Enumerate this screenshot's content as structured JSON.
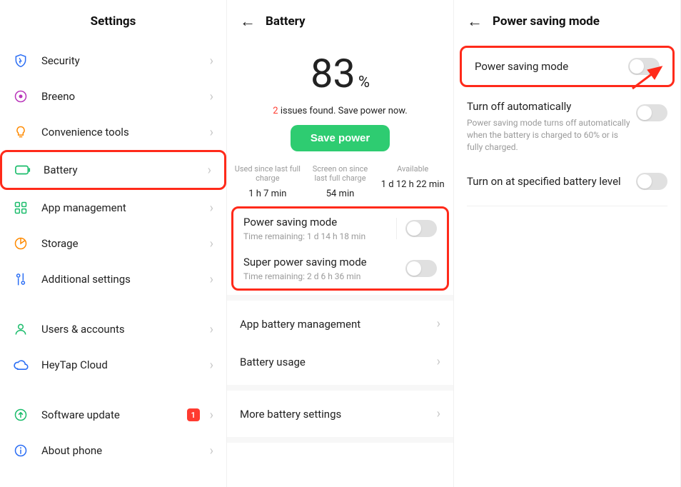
{
  "panel1": {
    "title": "Settings",
    "items": [
      {
        "label": "Security",
        "icon": "shield",
        "color": "#2a6df4"
      },
      {
        "label": "Breeno",
        "icon": "circle-dot",
        "color": "#b935ba"
      },
      {
        "label": "Convenience tools",
        "icon": "bulb",
        "color": "#ff8a00"
      },
      {
        "label": "Battery",
        "icon": "battery",
        "color": "#1abc6b",
        "highlight": true
      },
      {
        "label": "App management",
        "icon": "grid",
        "color": "#1abc6b"
      },
      {
        "label": "Storage",
        "icon": "pie",
        "color": "#ff8a00"
      },
      {
        "label": "Additional settings",
        "icon": "sliders",
        "color": "#2a6df4"
      }
    ],
    "group2": [
      {
        "label": "Users & accounts",
        "icon": "user",
        "color": "#1abc6b"
      },
      {
        "label": "HeyTap Cloud",
        "icon": "cloud",
        "color": "#2a6df4"
      }
    ],
    "group3": [
      {
        "label": "Software update",
        "icon": "arrow-up-circle",
        "color": "#1abc6b",
        "badge": "1"
      },
      {
        "label": "About phone",
        "icon": "info",
        "color": "#2a6df4"
      }
    ]
  },
  "panel2": {
    "title": "Battery",
    "percent_num": "83",
    "percent_sym": "%",
    "issues_count": "2",
    "issues_text": " issues found. Save power now.",
    "save_btn": "Save power",
    "stats": [
      {
        "label": "Used since last full charge",
        "value": "1 h 7 min"
      },
      {
        "label": "Screen on since last full charge",
        "value": "54 min"
      },
      {
        "label": "Available",
        "value": "1 d 12 h 22 min"
      }
    ],
    "modes": [
      {
        "title": "Power saving mode",
        "sub_prefix": "Time remaining:  ",
        "sub_value": "1 d 14 h 18 min"
      },
      {
        "title": "Super power saving mode",
        "sub_prefix": "Time remaining:  ",
        "sub_value": "2 d 6 h 36 min"
      }
    ],
    "links": [
      {
        "label": "App battery management"
      },
      {
        "label": "Battery usage"
      }
    ],
    "more": "More battery settings"
  },
  "panel3": {
    "title": "Power saving mode",
    "rows": [
      {
        "title": "Power saving mode",
        "sub": "",
        "highlight": true
      },
      {
        "title": "Turn off automatically",
        "sub": "Power saving mode turns off automatically when the battery is charged to 60% or is fully charged."
      },
      {
        "title": "Turn on at specified battery level",
        "sub": ""
      }
    ]
  }
}
